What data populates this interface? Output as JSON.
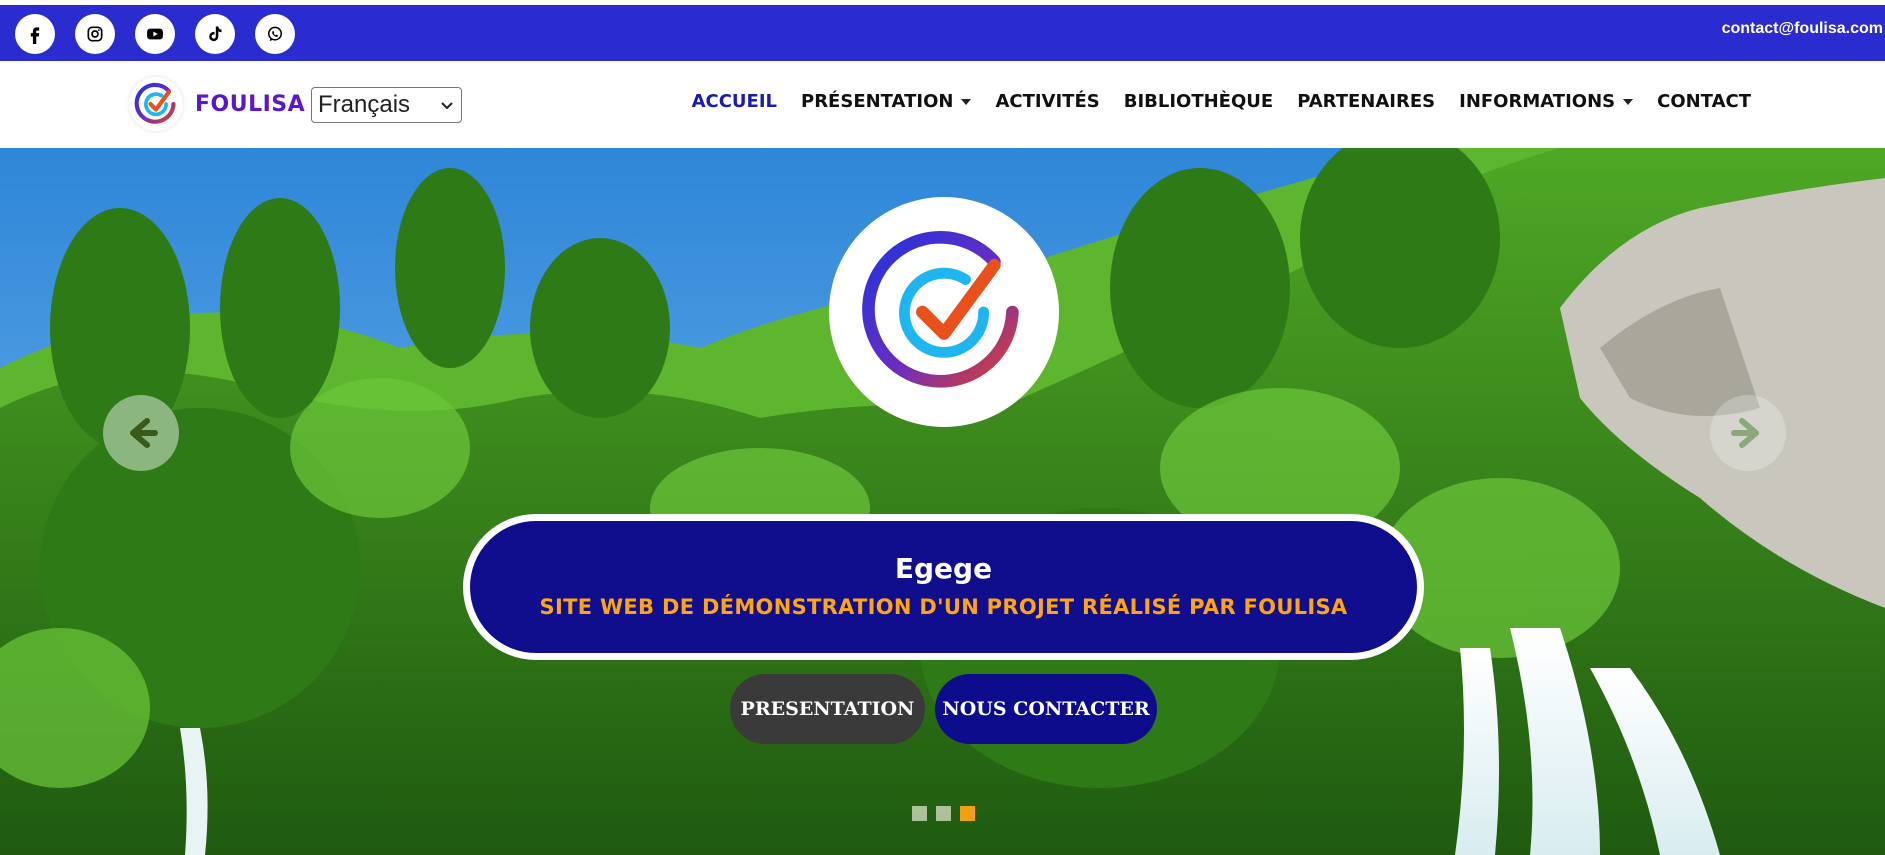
{
  "topbar": {
    "social": [
      {
        "name": "facebook",
        "icon": "facebook-icon"
      },
      {
        "name": "instagram",
        "icon": "instagram-icon"
      },
      {
        "name": "youtube",
        "icon": "youtube-icon"
      },
      {
        "name": "tiktok",
        "icon": "tiktok-icon"
      },
      {
        "name": "whatsapp",
        "icon": "whatsapp-icon"
      }
    ],
    "email": "contact@foulisa.com"
  },
  "navbar": {
    "brand_name": "FOULISA",
    "language_select": {
      "selected": "Français"
    },
    "menu": {
      "accueil": "ACCUEIL",
      "presentation": "PRÉSENTATION",
      "activites": "ACTIVITÉS",
      "bibliotheque": "BIBLIOTHÈQUE",
      "partenaires": "PARTENAIRES",
      "informations": "INFORMATIONS",
      "contact": "CONTACT"
    },
    "active_item": "ACCUEIL"
  },
  "hero": {
    "caption_title": "Egege",
    "caption_subtitle": "SITE WEB DE DÉMONSTRATION D'UN PROJET RÉALISÉ PAR FOULISA",
    "buttons": {
      "presentation": "PRESENTATION",
      "contact": "NOUS CONTACTER"
    },
    "carousel": {
      "slides": 3,
      "active_index": 2
    }
  },
  "colors": {
    "topbar_bg": "#2a2ccf",
    "brand": "#5b17cf",
    "nav_active": "#1b1bb5",
    "caption_bg": "#100e8c",
    "caption_subtitle": "#ffa412",
    "indicator_active": "#f0a010"
  }
}
